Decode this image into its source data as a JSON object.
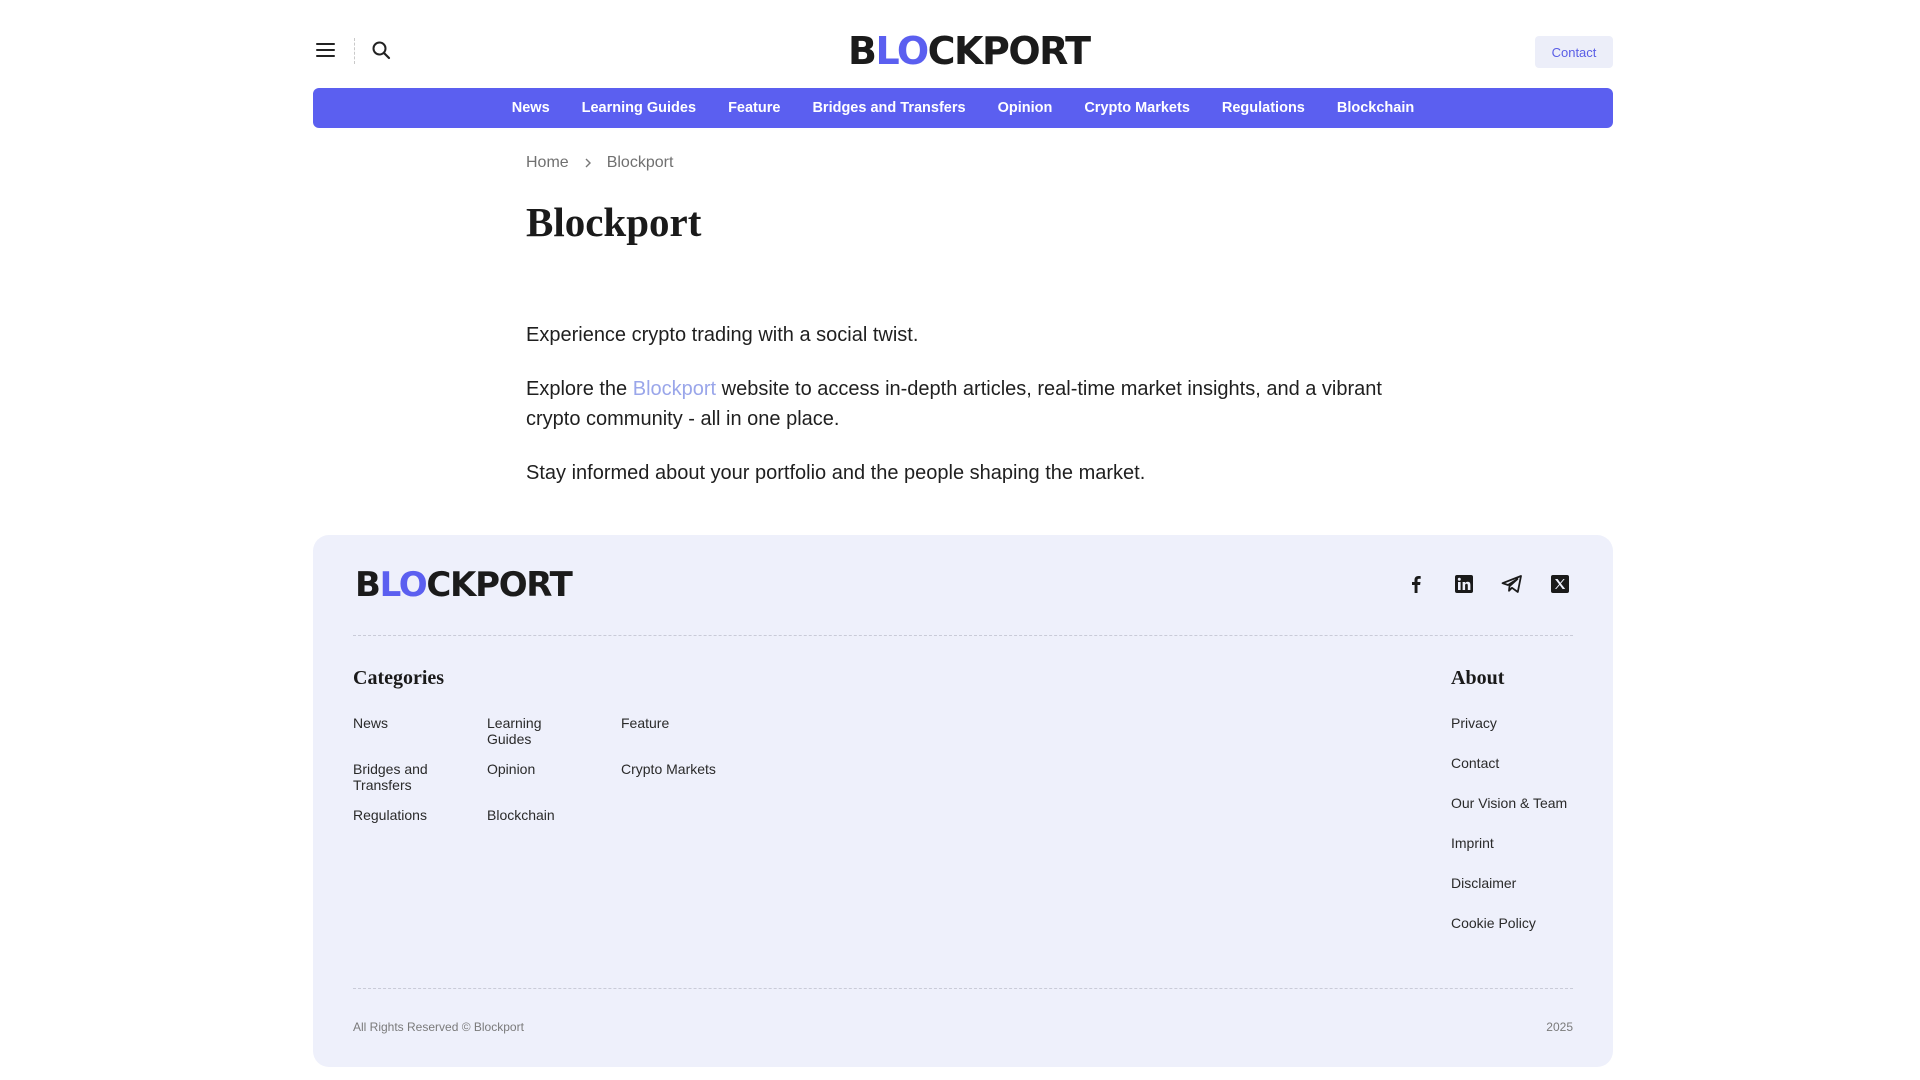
{
  "brand": {
    "logo_prefix": "B",
    "logo_accent": "LO",
    "logo_suffix": "CKPORT",
    "accent_color": "#5b5ff0"
  },
  "header": {
    "contact_label": "Contact",
    "menu_icon": "hamburger-menu-icon",
    "search_icon": "search-icon"
  },
  "nav": {
    "items": [
      "News",
      "Learning Guides",
      "Feature",
      "Bridges and Transfers",
      "Opinion",
      "Crypto Markets",
      "Regulations",
      "Blockchain"
    ]
  },
  "breadcrumb": {
    "home": "Home",
    "current": "Blockport"
  },
  "page": {
    "title": "Blockport",
    "p1": "Experience crypto trading with a social twist.",
    "p2_before": "Explore the ",
    "p2_link": "Blockport",
    "p2_after": " website to access in-depth articles, real-time market insights, and a vibrant crypto community - all in one place.",
    "p3": "Stay informed about your portfolio and the people shaping the market."
  },
  "footer": {
    "socials": [
      "facebook-icon",
      "linkedin-icon",
      "telegram-icon",
      "x-icon"
    ],
    "categories_title": "Categories",
    "categories": [
      "News",
      "Learning Guides",
      "Feature",
      "Bridges and Transfers",
      "Opinion",
      "Crypto Markets",
      "Regulations",
      "Blockchain"
    ],
    "about_title": "About",
    "about": [
      "Privacy",
      "Contact",
      "Our Vision & Team",
      "Imprint",
      "Disclaimer",
      "Cookie Policy"
    ],
    "copyright": "All Rights Reserved © Blockport",
    "year": "2025"
  }
}
